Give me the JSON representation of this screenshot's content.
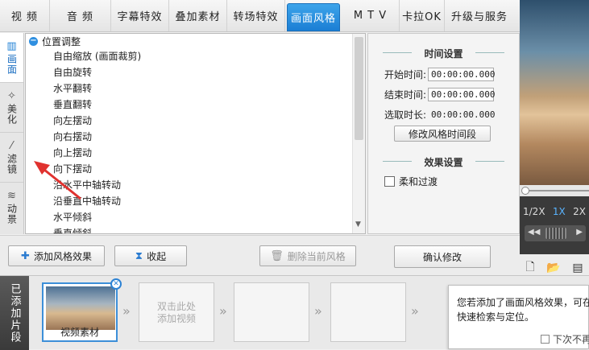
{
  "topbar": {
    "tabs": [
      {
        "label": "视 频"
      },
      {
        "label": "音 频"
      },
      {
        "label": "字幕特效"
      },
      {
        "label": "叠加素材"
      },
      {
        "label": "转场特效"
      },
      {
        "label": "画面风格"
      },
      {
        "label": "M T V"
      },
      {
        "label": "卡拉OK"
      },
      {
        "label": "升级与服务"
      }
    ]
  },
  "side_tabs": {
    "items": [
      {
        "label": "画面"
      },
      {
        "label": "美化"
      },
      {
        "label": "滤镜"
      },
      {
        "label": "动景"
      }
    ]
  },
  "style_list": {
    "group": "位置调整",
    "items": [
      "自由缩放 (画面裁剪)",
      "自由旋转",
      "水平翻转",
      "垂直翻转",
      "向左摆动",
      "向右摆动",
      "向上摆动",
      "向下摆动",
      "沿水平中轴转动",
      "沿垂直中轴转动",
      "水平倾斜",
      "垂直倾斜"
    ]
  },
  "settings": {
    "time_title": "时间设置",
    "start_label": "开始时间:",
    "start_value": "00:00:00.000",
    "end_label": "结束时间:",
    "end_value": "00:00:00.000",
    "duration_label": "选取时长:",
    "duration_value": "00:00:00.000",
    "modify_time_btn": "修改风格时间段",
    "effect_title": "效果设置",
    "smooth_label": "柔和过渡",
    "confirm_btn": "确认修改"
  },
  "toolbar": {
    "add_btn": "添加风格效果",
    "collapse_btn": "收起",
    "delete_btn": "删除当前风格"
  },
  "player": {
    "speeds": [
      "1/2X",
      "1X",
      "2X"
    ],
    "active_speed": "1X"
  },
  "timeline": {
    "label": "已添加片段",
    "clip_label": "视频素材",
    "empty_hint_line1": "双击此处",
    "empty_hint_line2": "添加视频"
  },
  "tooltip": {
    "line1": "您若添加了画面风格效果，可在",
    "line2": "快速检索与定位。",
    "dont_show": "下次不再"
  }
}
